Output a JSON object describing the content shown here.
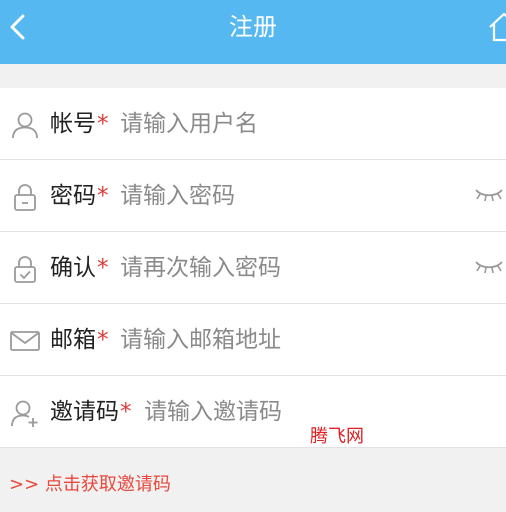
{
  "header": {
    "title": "注册",
    "background": "#55b8f1",
    "back_icon": "chevron-left-icon",
    "home_icon": "home-icon"
  },
  "form": {
    "fields": [
      {
        "label": "帐号",
        "required_mark": "*",
        "placeholder": "请输入用户名",
        "icon": "user-icon"
      },
      {
        "label": "密码",
        "required_mark": "*",
        "placeholder": "请输入密码",
        "icon": "lock-icon",
        "toggle_icon": "eye-closed-icon"
      },
      {
        "label": "确认",
        "required_mark": "*",
        "placeholder": "请再次输入密码",
        "icon": "lock-check-icon",
        "toggle_icon": "eye-closed-icon"
      },
      {
        "label": "邮箱",
        "required_mark": "*",
        "placeholder": "请输入邮箱地址",
        "icon": "mail-icon"
      },
      {
        "label": "邀请码",
        "required_mark": "*",
        "placeholder": "请输入邀请码",
        "icon": "add-user-icon"
      }
    ]
  },
  "invite_link": {
    "label": ">> 点击获取邀请码",
    "color": "#e8483d"
  },
  "watermark": {
    "text": "腾飞网"
  }
}
